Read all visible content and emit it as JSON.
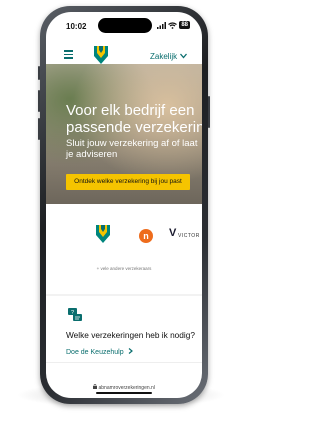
{
  "status_bar": {
    "time": "10:02",
    "battery": "88",
    "signal_icon": "signal-icon",
    "wifi_icon": "wifi-icon"
  },
  "nav": {
    "menu_icon": "hamburger-menu-icon",
    "brand_logo": "abn-amro-shield-logo",
    "segment_label": "Zakelijk",
    "segment_icon": "chevron-down-icon",
    "search_icon": "search-icon"
  },
  "hero": {
    "title": "Voor elk bedrijf een passende verzekering",
    "subtitle": "Sluit jouw verzekering af of laat je adviseren",
    "cta_label": "Ontdek welke verzekering bij jou past"
  },
  "partners": {
    "logos": [
      "abn-amro-logo",
      "nn-logo",
      "victor-logo"
    ],
    "nn_label": "n",
    "victor_label": "VICTOR",
    "more_text": "+ vele andere verzekeraars"
  },
  "helper": {
    "icon": "chat-question-icon",
    "title": "Welke verzekeringen heb ik nodig?",
    "link_label": "Doe de Keuzehulp",
    "link_icon": "chevron-right-icon"
  },
  "browser": {
    "lock_icon": "lock-icon",
    "url": "abnamroverzekeringen.nl"
  },
  "colors": {
    "brand_teal": "#0a6e6e",
    "cta_yellow": "#f5c400",
    "nn_orange": "#ee6c1c"
  }
}
